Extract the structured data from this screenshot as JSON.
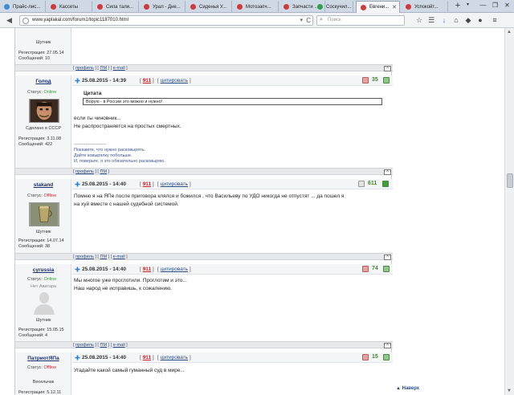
{
  "browser": {
    "tabs": [
      {
        "title": "Прайс-лис...",
        "icon_color": "#3b8fd8"
      },
      {
        "title": "Кассеты",
        "icon_color": "#d23a3a"
      },
      {
        "title": "Сила тали...",
        "icon_color": "#d23a3a"
      },
      {
        "title": "Урал - Дне...",
        "icon_color": "#d23a3a"
      },
      {
        "title": "Сиденья У...",
        "icon_color": "#d23a3a"
      },
      {
        "title": "Мотозапч...",
        "icon_color": "#d23a3a"
      },
      {
        "title": "Запчасти ...",
        "icon_color": "#d23a3a"
      },
      {
        "title": "Соскучил...",
        "icon_color": "#2ea24a"
      },
      {
        "title": "Евгени...",
        "icon_color": "#d23a3a",
        "active": true
      },
      {
        "title": "Успокойт...",
        "icon_color": "#d23a3a"
      }
    ],
    "new_tab": "+",
    "tab_list": "▾",
    "window": {
      "minimize": "—",
      "maximize": "❐",
      "close": "✕"
    },
    "url": "www.yaplakal.com/forum1/topic1187010.html",
    "search_placeholder": "Поиск",
    "nav": {
      "back": "◀",
      "reload": "C",
      "dropdown": "▾"
    }
  },
  "posts": [
    {
      "status_label": "",
      "rank": "Шутник",
      "reg": "Регистрация: 27.05.14",
      "msgs": "Сообщений: 10"
    },
    {
      "username": "Голод",
      "status_label": "Статус:",
      "status_value": "Online",
      "rank": "Сделано в СССР",
      "reg": "Регистрация: 3.11.08",
      "msgs": "Сообщений: 422",
      "date": "25.08.2015 - 14:39",
      "report": "911",
      "quote_btn": "цитировать",
      "rating": "35",
      "quote_title": "Цитата",
      "quote_text": "Ворую - в России это можно и нужно!",
      "lines": [
        "если ты чиновник...",
        "Не распространяется на простых смертных."
      ],
      "sig_sep": "----------------------",
      "sig": [
        "Покажите, что нужно расковырять.",
        "Дайте ковырялку побольше.",
        "И, поверьте, я это обязательно расковыряю."
      ]
    },
    {
      "username": "stakand",
      "status_label": "Статус:",
      "status_value": "Offline",
      "rank": "Шутник",
      "reg": "Регистрация: 14.07.14",
      "msgs": "Сообщений: 38",
      "date": "25.08.2015 - 14:40",
      "report": "911",
      "quote_btn": "цитировать",
      "rating": "611",
      "lines": [
        "Помню я на ЯПе после приговора клялся и божился , что Васильеву по УДО никогда не отпустят ... да пошел я",
        "на хуй вместе с нашей судебной системой."
      ]
    },
    {
      "username": "cyrussia",
      "status_label": "Статус:",
      "status_value": "Online",
      "no_avatar": "Нет Аватара",
      "rank": "Шутник",
      "reg": "Регистрация: 15.05.15",
      "msgs": "Сообщений: 4",
      "date": "25.08.2015 - 14:40",
      "report": "911",
      "quote_btn": "цитировать",
      "rating": "74",
      "lines": [
        "Мы многое уже проглотили. Проглотим и это...",
        "Наш народ не исправишь, к сожалению."
      ]
    },
    {
      "username": "ПатриотЯПа",
      "status_label": "Статус:",
      "status_value": "Offline",
      "rank": "Весельчак",
      "reg": "Регистрация: 5.12.11",
      "date": "25.08.2015 - 14:40",
      "report": "911",
      "quote_btn": "цитировать",
      "rating": "15",
      "lines": [
        "Угадайте какой самый гуманный суд в мире..."
      ]
    }
  ],
  "footer_links": {
    "profile": "профиль",
    "pm": "ПМ",
    "email": "e-mail",
    "to_top": "^"
  },
  "next_link": "▲ Наверх",
  "colors": {
    "rating_green": "#3d8a22",
    "online": "#2ea22e",
    "offline": "#cc2a2a",
    "link": "#2a4f86"
  }
}
